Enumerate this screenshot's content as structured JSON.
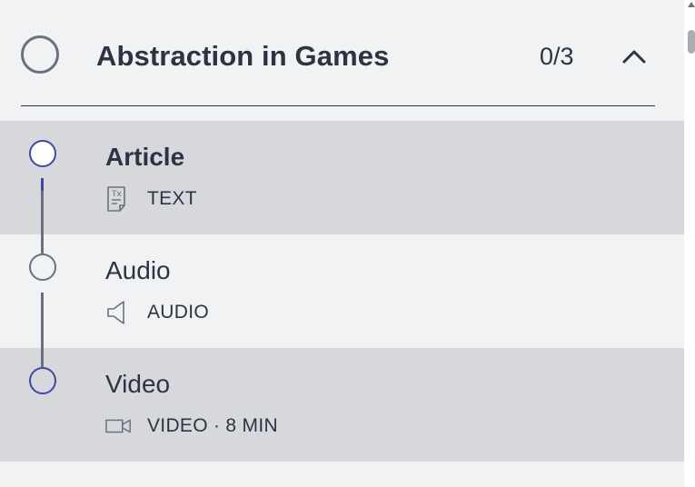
{
  "module": {
    "title": "Abstraction in Games",
    "progress": "0/3"
  },
  "items": [
    {
      "title": "Article",
      "type_label": "TEXT",
      "icon": "text-document-icon"
    },
    {
      "title": "Audio",
      "type_label": "AUDIO",
      "icon": "speaker-icon"
    },
    {
      "title": "Video",
      "type_label": "VIDEO · 8 MIN",
      "icon": "video-camera-icon"
    }
  ],
  "colors": {
    "accent": "#3f4a9e",
    "neutral": "#6b7081",
    "selected_bg": "#d6d8dc",
    "panel_bg": "#f1f2f4"
  }
}
